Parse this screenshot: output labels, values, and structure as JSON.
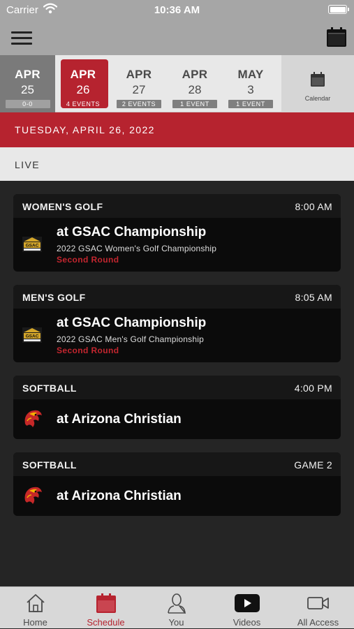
{
  "status_bar": {
    "carrier": "Carrier",
    "time": "10:36 AM"
  },
  "colors": {
    "accent": "#b6232f",
    "card_bg": "#0b0b0b",
    "page_bg": "#252525",
    "round_text": "#c3262f"
  },
  "date_strip": {
    "dates": [
      {
        "month": "APR",
        "day": "25",
        "count": "0-0"
      },
      {
        "month": "APR",
        "day": "26",
        "count": "4 EVENTS"
      },
      {
        "month": "APR",
        "day": "27",
        "count": "2 EVENTS"
      },
      {
        "month": "APR",
        "day": "28",
        "count": "1 EVENT"
      },
      {
        "month": "MAY",
        "day": "3",
        "count": "1 EVENT"
      }
    ],
    "calendar_label": "Calendar"
  },
  "date_banner": "TUESDAY, APRIL 26, 2022",
  "section_label": "LIVE",
  "events": [
    {
      "sport": "WOMEN'S GOLF",
      "time": "8:00 AM",
      "title": "at GSAC Championship",
      "subtitle": "2022 GSAC Women's Golf Championship",
      "round": "Second Round",
      "logo": "gsac-logo"
    },
    {
      "sport": "MEN'S GOLF",
      "time": "8:05 AM",
      "title": "at GSAC Championship",
      "subtitle": "2022 GSAC Men's Golf Championship",
      "round": "Second Round",
      "logo": "gsac-logo"
    },
    {
      "sport": "SOFTBALL",
      "time": "4:00 PM",
      "title": "at Arizona Christian",
      "logo": "firestorm-logo"
    },
    {
      "sport": "SOFTBALL",
      "time": "GAME 2",
      "title": "at Arizona Christian",
      "logo": "firestorm-logo"
    }
  ],
  "tab_bar": {
    "tabs": [
      {
        "label": "Home",
        "icon": "home-icon"
      },
      {
        "label": "Schedule",
        "icon": "calendar-icon",
        "active": true
      },
      {
        "label": "You",
        "icon": "person-icon"
      },
      {
        "label": "Videos",
        "icon": "play-icon"
      },
      {
        "label": "All Access",
        "icon": "video-camera-icon"
      }
    ]
  }
}
